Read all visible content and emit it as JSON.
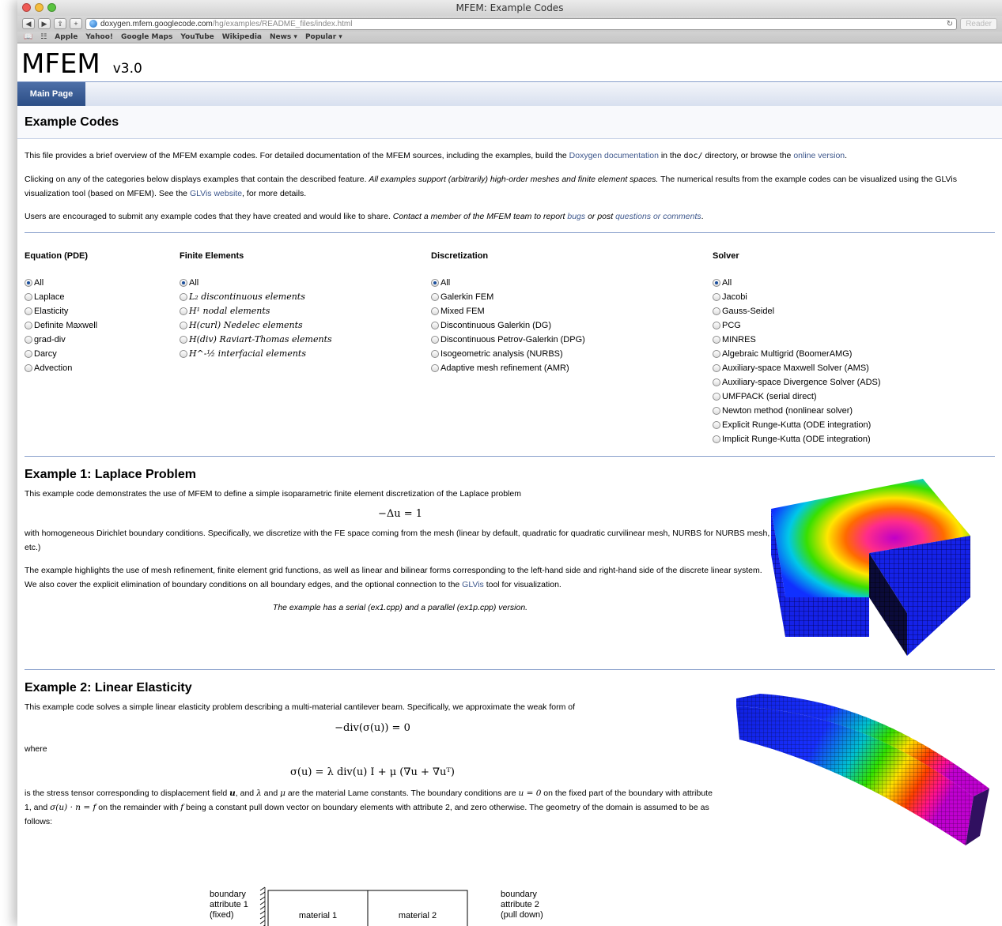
{
  "browser": {
    "title": "MFEM: Example Codes",
    "url_host": "doxygen.mfem.googlecode.com",
    "url_path": "/hg/examples/README_files/index.html",
    "reader": "Reader",
    "bookmarks": [
      "Apple",
      "Yahoo!",
      "Google Maps",
      "YouTube",
      "Wikipedia",
      "News ▾",
      "Popular ▾"
    ]
  },
  "site": {
    "name": "MFEM",
    "version": "v3.0",
    "nav_tab": "Main Page"
  },
  "page": {
    "title": "Example Codes",
    "intro1_a": "This file provides a brief overview of the MFEM example codes. For detailed documentation of the MFEM sources, including the examples, build the ",
    "intro1_link1": "Doxygen documentation",
    "intro1_b": " in the ",
    "intro1_code": "doc/",
    "intro1_c": " directory, or browse the ",
    "intro1_link2": "online version",
    "intro1_d": ".",
    "intro2_a": "Clicking on any of the categories below displays examples that contain the described feature. ",
    "intro2_em": "All examples support (arbitrarily) high-order meshes and finite element spaces.",
    "intro2_b": " The numerical results from the example codes can be visualized using the GLVis visualization tool (based on MFEM). See the ",
    "intro2_link": "GLVis website",
    "intro2_c": ", for more details.",
    "intro3_a": "Users are encouraged to submit any example codes that they have created and would like to share. ",
    "intro3_em": "Contact a member of the MFEM team to report ",
    "intro3_link1": "bugs",
    "intro3_em2": " or post ",
    "intro3_link2": "questions or comments",
    "intro3_d": "."
  },
  "filters": {
    "equation": {
      "heading": "Equation (PDE)",
      "options": [
        "All",
        "Laplace",
        "Elasticity",
        "Definite Maxwell",
        "grad-div",
        "Darcy",
        "Advection"
      ]
    },
    "elements": {
      "heading": "Finite Elements",
      "options": [
        "All",
        "L₂ discontinuous elements",
        "H¹ nodal elements",
        "H(curl) Nedelec elements",
        "H(div) Raviart-Thomas elements",
        "H^-½ interfacial elements"
      ]
    },
    "discretization": {
      "heading": "Discretization",
      "options": [
        "All",
        "Galerkin FEM",
        "Mixed FEM",
        "Discontinuous Galerkin (DG)",
        "Discontinuous Petrov-Galerkin (DPG)",
        "Isogeometric analysis (NURBS)",
        "Adaptive mesh refinement (AMR)"
      ]
    },
    "solver": {
      "heading": "Solver",
      "options": [
        "All",
        "Jacobi",
        "Gauss-Seidel",
        "PCG",
        "MINRES",
        "Algebraic Multigrid (BoomerAMG)",
        "Auxiliary-space Maxwell Solver (AMS)",
        "Auxiliary-space Divergence Solver (ADS)",
        "UMFPACK (serial direct)",
        "Newton method (nonlinear solver)",
        "Explicit Runge-Kutta (ODE integration)",
        "Implicit Runge-Kutta (ODE integration)"
      ]
    }
  },
  "ex1": {
    "title": "Example 1: Laplace Problem",
    "p1": "This example code demonstrates the use of MFEM to define a simple isoparametric finite element discretization of the Laplace problem",
    "eq": "−Δu = 1",
    "p2": "with homogeneous Dirichlet boundary conditions. Specifically, we discretize with the FE space coming from the mesh (linear by default, quadratic for quadratic curvilinear mesh, NURBS for NURBS mesh, etc.)",
    "p3_a": "The example highlights the use of mesh refinement, finite element grid functions, as well as linear and bilinear forms corresponding to the left-hand side and right-hand side of the discrete linear system. We also cover the explicit elimination of boundary conditions on all boundary edges, and the optional connection to the ",
    "p3_link": "GLVis",
    "p3_b": " tool for visualization.",
    "caption": "The example has a serial (ex1.cpp) and a parallel (ex1p.cpp) version."
  },
  "ex2": {
    "title": "Example 2: Linear Elasticity",
    "p1": "This example code solves a simple linear elasticity problem describing a multi-material cantilever beam. Specifically, we approximate the weak form of",
    "eq1": "−div(σ(u)) = 0",
    "where": "where",
    "eq2": "σ(u) = λ div(u) I + μ (∇u + ∇uᵀ)",
    "p2_a": "is the stress tensor corresponding to displacement field ",
    "u": "u",
    "p2_b": ", and ",
    "lambda": "λ",
    "p2_c": " and ",
    "mu": "μ",
    "p2_d": " are the material Lame constants. The boundary conditions are ",
    "bc1": "u = 0",
    "p2_e": " on the fixed part of the boundary with attribute 1, and ",
    "bc2": "σ(u) · n = f",
    "p2_f": " on the remainder with ",
    "f": "f",
    "p2_g": " being a constant pull down vector on boundary elements with attribute 2, and zero otherwise. The geometry of the domain is assumed to be as follows:",
    "diagram": {
      "left_label": [
        "boundary",
        "attribute 1",
        "(fixed)"
      ],
      "mat1": "material 1",
      "mat2": "material 2",
      "right_label": [
        "boundary",
        "attribute 2",
        "(pull down)"
      ]
    }
  }
}
